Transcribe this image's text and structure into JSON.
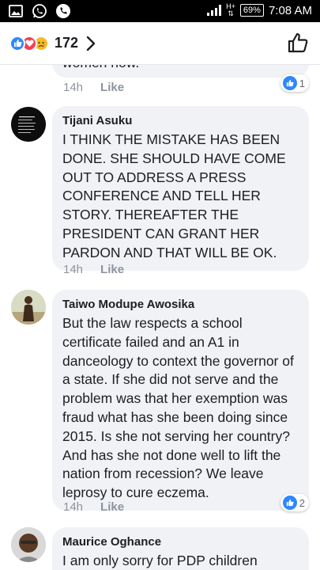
{
  "status_bar": {
    "network": "H+",
    "battery": "69%",
    "time": "7:08 AM"
  },
  "header": {
    "reaction_count": "172",
    "reaction_icons": [
      "like-icon",
      "love-icon",
      "sad-icon"
    ]
  },
  "comments": [
    {
      "author": "",
      "text": "women now.",
      "time": "14h",
      "like_label": "Like",
      "reactions": "1"
    },
    {
      "author": "Tijani Asuku",
      "text": "I THINK THE MISTAKE HAS BEEN DONE. SHE SHOULD HAVE COME OUT TO ADDRESS A PRESS CONFERENCE AND TELL HER STORY.  THEREAFTER THE PRESIDENT CAN GRANT HER PARDON AND THAT WILL BE OK.",
      "time": "14h",
      "like_label": "Like"
    },
    {
      "author": "Taiwo Modupe Awosika",
      "text": "But the law respects a school certificate failed and an A1 in danceology to context the governor of  a state. If she did not serve and the problem was that  her exemption was fraud what has she been doing since 2015.  Is she not serving her country? And has she not done well to lift the nation from recession? We leave leprosy to cure eczema.",
      "time": "14h",
      "like_label": "Like",
      "reactions": "2"
    },
    {
      "author": "Maurice Oghance",
      "text": "I am only sorry for PDP children",
      "time": "",
      "like_label": ""
    }
  ]
}
